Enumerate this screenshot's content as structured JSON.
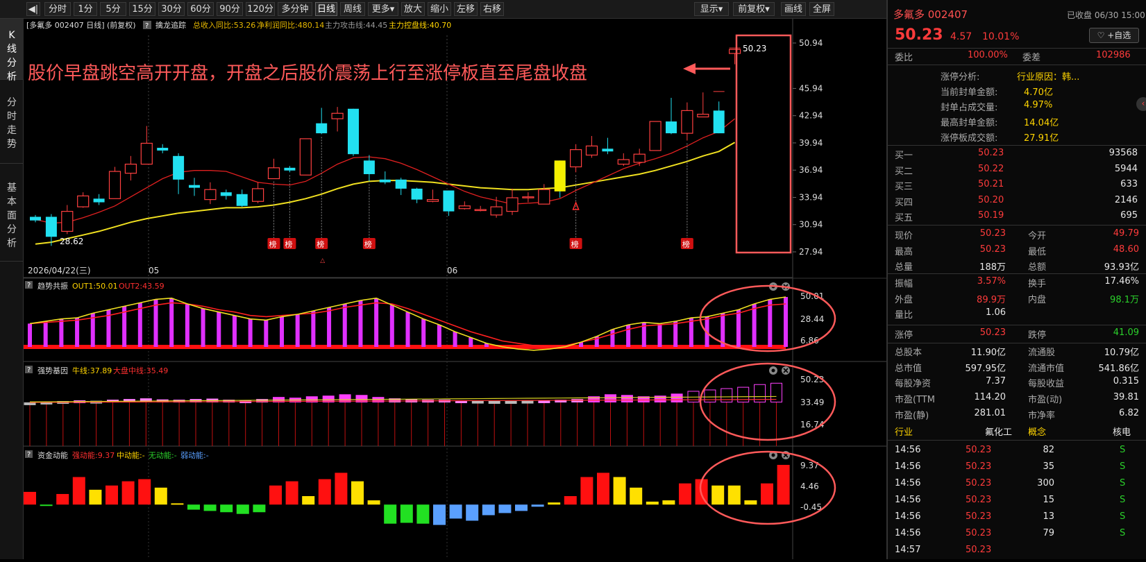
{
  "toolbar": {
    "left": "◀|",
    "items": [
      "分时",
      "1分",
      "5分",
      "15分",
      "30分",
      "60分",
      "90分",
      "120分",
      "多分钟",
      "日线",
      "周线",
      "更多▾",
      "放大",
      "缩小",
      "左移",
      "右移"
    ],
    "right": [
      "显示▾",
      "前复权▾",
      "画线",
      "全屏"
    ]
  },
  "leftbar": [
    "K线分析",
    "分时走势",
    "基本面分析"
  ],
  "chart": {
    "header": {
      "name": "[多氟多 002407 日线]",
      "adj": "(前复权)",
      "q": "?",
      "ind": "擒龙追踪",
      "income": "总收入同比:53.26",
      "profit": "净利润同比:480.14",
      "main": "主力攻击线:44.45",
      "ctrl": "主力控盘线:40.70"
    },
    "annotation": "股价早盘跳空高开开盘，开盘之后股价震荡上行至涨停板直至尾盘收盘",
    "price_ticks": [
      "50.94",
      "45.94",
      "42.94",
      "39.94",
      "36.94",
      "33.94",
      "30.94",
      "27.94"
    ],
    "low_label": "28.62",
    "high_label": "50.23",
    "dates": [
      "2026/04/22(三)",
      "05",
      "06"
    ],
    "bang": "榜",
    "p1": {
      "q": "?",
      "name": "趋势共振",
      "out1": "OUT1:50.01",
      "out2": "OUT2:43.59",
      "ticks": [
        "50.01",
        "28.44",
        "6.86"
      ]
    },
    "p2": {
      "q": "?",
      "name": "强势基因",
      "a": "牛线:37.89",
      "b": "大盘中线:35.49",
      "ticks": [
        "50.23",
        "33.49",
        "16.74"
      ]
    },
    "p3": {
      "q": "?",
      "name": "资金动能",
      "a": "强动能:9.37",
      "b": "中动能:-",
      "c": "无动能:-",
      "d": "弱动能:-",
      "ticks": [
        "9.37",
        "4.46",
        "-0.45"
      ]
    }
  },
  "chart_data": [
    {
      "type": "candlestick",
      "title": "多氟多 002407 日线",
      "ylim": [
        27.94,
        50.94
      ],
      "candles": [
        [
          31.8,
          31.4,
          32.0,
          31.2
        ],
        [
          31.8,
          29.6,
          32.1,
          28.6
        ],
        [
          30.2,
          32.4,
          33.1,
          29.9
        ],
        [
          32.9,
          34.1,
          34.5,
          32.8
        ],
        [
          33.8,
          33.4,
          34.3,
          33.1
        ],
        [
          33.8,
          36.8,
          37.3,
          33.8
        ],
        [
          36.6,
          37.6,
          38.5,
          35.8
        ],
        [
          37.6,
          39.9,
          41.8,
          37.6
        ],
        [
          39.4,
          39.1,
          39.8,
          38.8
        ],
        [
          38.5,
          35.9,
          38.8,
          34.3
        ],
        [
          35.3,
          35.0,
          36.1,
          34.1
        ],
        [
          33.7,
          34.8,
          35.6,
          33.2
        ],
        [
          34.5,
          34.1,
          34.8,
          33.7
        ],
        [
          34.3,
          33.0,
          34.8,
          32.9
        ],
        [
          33.5,
          34.9,
          35.6,
          33.3
        ],
        [
          36.0,
          37.2,
          38.2,
          36.0
        ],
        [
          37.2,
          36.9,
          37.4,
          36.7
        ],
        [
          36.4,
          40.4,
          40.4,
          36.4
        ],
        [
          42.1,
          41.0,
          43.8,
          40.9
        ],
        [
          42.6,
          43.2,
          43.9,
          41.2
        ],
        [
          43.7,
          38.7,
          43.7,
          38.5
        ],
        [
          38.0,
          36.5,
          38.6,
          35.7
        ],
        [
          35.9,
          35.6,
          36.8,
          35.4
        ],
        [
          35.9,
          34.9,
          36.1,
          34.2
        ],
        [
          34.9,
          33.7,
          35.0,
          33.3
        ],
        [
          33.5,
          33.7,
          34.8,
          33.4
        ],
        [
          34.7,
          32.4,
          34.7,
          31.9
        ],
        [
          32.7,
          33.0,
          33.5,
          32.6
        ],
        [
          32.6,
          32.6,
          33.0,
          32.4
        ],
        [
          32.0,
          32.9,
          34.0,
          31.7
        ],
        [
          32.4,
          33.9,
          34.9,
          32.0
        ],
        [
          33.9,
          34.0,
          34.5,
          33.4
        ],
        [
          33.2,
          34.8,
          35.4,
          33.2
        ],
        [
          37.8,
          35.1,
          38.0,
          33.9
        ],
        [
          37.3,
          39.2,
          39.8,
          36.7
        ],
        [
          38.6,
          39.6,
          40.7,
          38.3
        ],
        [
          39.3,
          39.0,
          40.5,
          38.7
        ],
        [
          37.6,
          38.1,
          38.8,
          37.4
        ],
        [
          37.8,
          38.7,
          39.3,
          37.4
        ],
        [
          39.1,
          42.3,
          42.3,
          39.1
        ],
        [
          42.3,
          41.0,
          44.9,
          40.9
        ],
        [
          41.0,
          43.5,
          44.4,
          40.2
        ],
        [
          42.8,
          43.1,
          45.5,
          42.8
        ],
        [
          43.5,
          41.0,
          44.5,
          41.0
        ],
        [
          49.79,
          50.23,
          50.23,
          48.6
        ]
      ],
      "ma_red": [
        31.5,
        31.1,
        31.2,
        31.7,
        32.3,
        33.0,
        34.0,
        35.0,
        36.0,
        36.7,
        36.9,
        36.9,
        36.8,
        36.2,
        35.6,
        35.4,
        35.3,
        35.7,
        36.6,
        37.6,
        38.3,
        38.4,
        38.2,
        37.7,
        37.0,
        36.2,
        35.4,
        34.6,
        34.0,
        33.6,
        33.2,
        33.3,
        33.4,
        33.8,
        34.7,
        35.5,
        36.3,
        37.1,
        37.7,
        38.2,
        38.8,
        39.6,
        40.5,
        41.2,
        42.6
      ],
      "ma_yellow": [
        28.8,
        29.0,
        29.4,
        29.8,
        30.2,
        30.7,
        31.2,
        31.6,
        31.9,
        32.2,
        32.4,
        32.6,
        32.8,
        32.8,
        32.9,
        33.1,
        33.4,
        33.8,
        34.3,
        34.9,
        35.4,
        35.7,
        35.8,
        35.8,
        35.7,
        35.6,
        35.4,
        35.2,
        35.0,
        34.9,
        34.8,
        34.8,
        34.9,
        35.0,
        35.3,
        35.6,
        35.9,
        36.2,
        36.5,
        36.9,
        37.4,
        37.9,
        38.5,
        39.0,
        40.0
      ]
    },
    {
      "type": "bar",
      "title": "趋势共振",
      "series": [
        {
          "name": "OUT1",
          "values": [
            27,
            29,
            31,
            32,
            36,
            39,
            42,
            45,
            48,
            49,
            44,
            40,
            37,
            34,
            31,
            30,
            33,
            35,
            38,
            41,
            44,
            47,
            49,
            43,
            37,
            31,
            26,
            20,
            15,
            10,
            7,
            5,
            4,
            5,
            7,
            11,
            16,
            22,
            26,
            28,
            27,
            29,
            32,
            33,
            36,
            39,
            44,
            48,
            50
          ]
        },
        {
          "name": "OUT2",
          "values": [
            27,
            28,
            29,
            30,
            32,
            34,
            37,
            40,
            43,
            45,
            44,
            42,
            39,
            37,
            34,
            33,
            34,
            35,
            36,
            38,
            41,
            43,
            45,
            44,
            40,
            35,
            30,
            25,
            20,
            16,
            12,
            10,
            8,
            7,
            8,
            11,
            14,
            18,
            22,
            25,
            26,
            27,
            29,
            31,
            34,
            36,
            40,
            43,
            44
          ]
        }
      ],
      "ylim": [
        6.86,
        50.01
      ]
    },
    {
      "type": "bar",
      "title": "强势基因",
      "series": [
        {
          "name": "牛线",
          "values": [
            37.89
          ]
        },
        {
          "name": "大盘中线",
          "values": [
            35.49
          ]
        }
      ],
      "ylim": [
        16.74,
        50.23
      ]
    },
    {
      "type": "bar",
      "title": "资金动能",
      "values": [
        3,
        -0.3,
        2.5,
        6.5,
        3.5,
        4.5,
        5.5,
        6,
        4,
        0.3,
        -1.2,
        -1.5,
        -1.8,
        -2.2,
        -1.8,
        4.5,
        5.5,
        2,
        6,
        7.5,
        5.5,
        1,
        -4.5,
        -4.3,
        -4.5,
        -4.8,
        -3.3,
        -3.8,
        -2.5,
        -2,
        -1.5,
        -0.5,
        0.5,
        2,
        6.5,
        7.5,
        6.5,
        4,
        0.7,
        1,
        5,
        6,
        4.5,
        4.5,
        1,
        5,
        9.37
      ],
      "ylim": [
        -6,
        10
      ]
    }
  ],
  "right": {
    "title": "多氟多 002407",
    "status": "已收盘 06/30 15:00",
    "price": "50.23",
    "chg": "4.57",
    "pct": "10.01%",
    "fav": "♡ +自选",
    "weibi_l": "委比",
    "weibi_v": "100.00%",
    "weicha_l": "委差",
    "weicha_v": "102986",
    "lu": [
      {
        "l": "涨停分析:",
        "v": "行业原因：韩..."
      },
      {
        "l": "当前封单金额:",
        "v": "4.70亿"
      },
      {
        "l": "封单占成交量:",
        "v": "4.97%"
      },
      {
        "l": "最高封单金额:",
        "v": "14.04亿"
      },
      {
        "l": "涨停板成交额:",
        "v": "27.91亿"
      }
    ],
    "bids": [
      {
        "l": "买一",
        "p": "50.23",
        "v": "93568"
      },
      {
        "l": "买二",
        "p": "50.22",
        "v": "5944"
      },
      {
        "l": "买三",
        "p": "50.21",
        "v": "633"
      },
      {
        "l": "买四",
        "p": "50.20",
        "v": "2146"
      },
      {
        "l": "买五",
        "p": "50.19",
        "v": "695"
      }
    ],
    "q1": [
      [
        "现价",
        "50.23",
        "今开",
        "49.79"
      ],
      [
        "最高",
        "50.23",
        "最低",
        "48.60"
      ],
      [
        "总量",
        "188万",
        "总额",
        "93.93亿"
      ]
    ],
    "q2": [
      [
        "振幅",
        "3.57%",
        "换手",
        "17.46%"
      ],
      [
        "外盘",
        "89.9万",
        "内盘",
        "98.1万"
      ],
      [
        "量比",
        "1.06",
        "",
        ""
      ]
    ],
    "q3": [
      [
        "涨停",
        "50.23",
        "跌停",
        "41.09"
      ]
    ],
    "q4": [
      [
        "总股本",
        "11.90亿",
        "流通股",
        "10.79亿"
      ],
      [
        "总市值",
        "597.95亿",
        "流通市值",
        "541.86亿"
      ],
      [
        "每股净资",
        "7.37",
        "每股收益",
        "0.315"
      ],
      [
        "市盈(TTM",
        "114.20",
        "市盈(动)",
        "39.81"
      ],
      [
        "市盈(静)",
        "281.01",
        "市净率",
        "6.82"
      ]
    ],
    "ind": [
      "行业",
      "氟化工",
      "概念",
      "核电"
    ],
    "ticks": [
      [
        "14:56",
        "50.23",
        "82",
        "S"
      ],
      [
        "14:56",
        "50.23",
        "35",
        "S"
      ],
      [
        "14:56",
        "50.23",
        "300",
        "S"
      ],
      [
        "14:56",
        "50.23",
        "15",
        "S"
      ],
      [
        "14:56",
        "50.23",
        "13",
        "S"
      ],
      [
        "14:56",
        "50.23",
        "79",
        "S"
      ],
      [
        "14:57",
        "50.23",
        "",
        ""
      ]
    ]
  }
}
